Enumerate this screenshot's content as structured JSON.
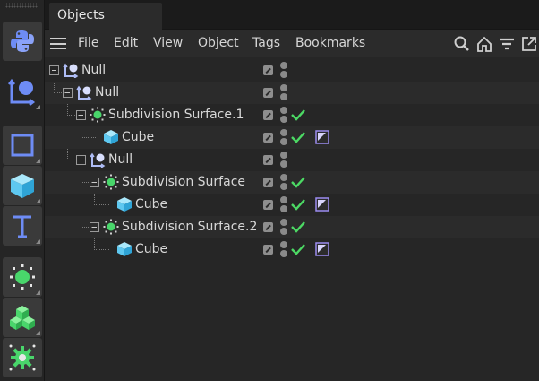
{
  "tabs": [
    {
      "label": "Objects"
    }
  ],
  "menu": {
    "items": [
      "File",
      "Edit",
      "View",
      "Object",
      "Tags",
      "Bookmarks"
    ],
    "right_icons": [
      "search-icon",
      "home-icon",
      "filter-icon",
      "new-window-icon"
    ]
  },
  "toolbar": {
    "tools": [
      "python-icon",
      "null-object-icon",
      "spline-rectangle-icon",
      "cube-primitive-icon",
      "text-spline-icon",
      "subdivision-generator-icon",
      "voronoi-fracture-icon",
      "effector-gear-icon"
    ]
  },
  "objects": [
    {
      "label": "Null",
      "type": "null",
      "depth": 0,
      "expanded": true,
      "checked": false,
      "has_tag": false
    },
    {
      "label": "Null",
      "type": "null",
      "depth": 1,
      "expanded": true,
      "checked": false,
      "has_tag": false
    },
    {
      "label": "Subdivision Surface.1",
      "type": "subdivision",
      "depth": 2,
      "expanded": true,
      "checked": true,
      "has_tag": false
    },
    {
      "label": "Cube",
      "type": "cube",
      "depth": 3,
      "expanded": false,
      "checked": true,
      "has_tag": true
    },
    {
      "label": "Null",
      "type": "null",
      "depth": 2,
      "expanded": true,
      "checked": false,
      "has_tag": false
    },
    {
      "label": "Subdivision Surface",
      "type": "subdivision",
      "depth": 3,
      "expanded": true,
      "checked": true,
      "has_tag": false
    },
    {
      "label": "Cube",
      "type": "cube",
      "depth": 4,
      "expanded": false,
      "checked": true,
      "has_tag": true
    },
    {
      "label": "Subdivision Surface.2",
      "type": "subdivision",
      "depth": 3,
      "expanded": true,
      "checked": true,
      "has_tag": false
    },
    {
      "label": "Cube",
      "type": "cube",
      "depth": 4,
      "expanded": false,
      "checked": true,
      "has_tag": true
    }
  ],
  "colors": {
    "check": "#4cd964",
    "cube": "#5ec8f0",
    "subdivision": "#49d66b",
    "tag": "#9b8cf0",
    "toolbar_accent": "#6e8cf5"
  }
}
